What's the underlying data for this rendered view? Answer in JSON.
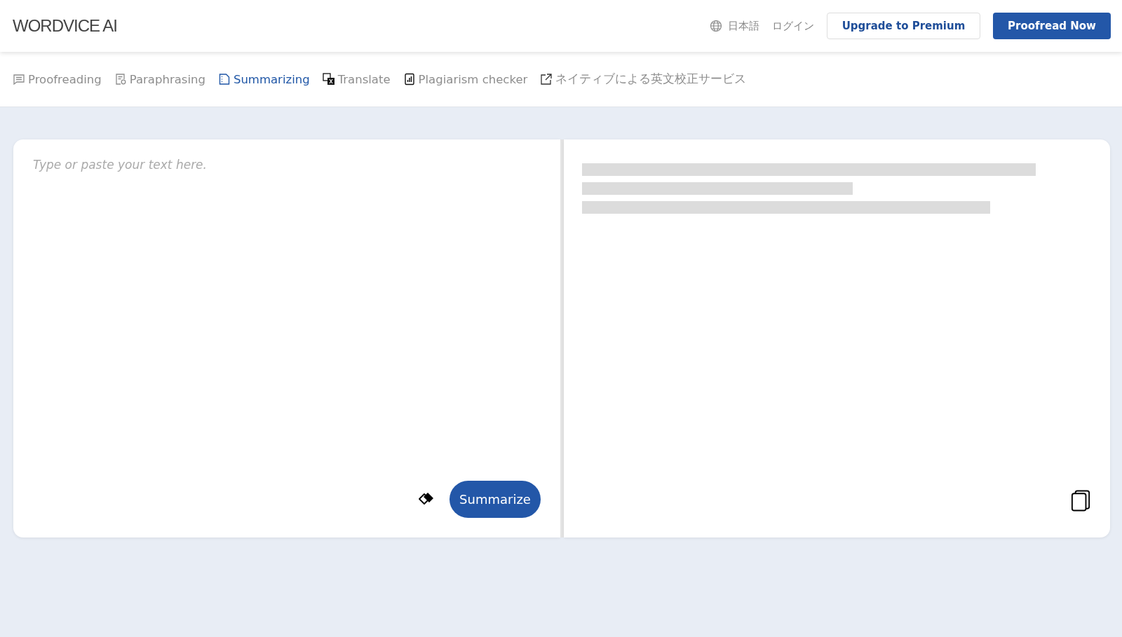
{
  "header": {
    "logo": "WORDVICE AI",
    "language": "日本語",
    "login": "ログイン",
    "upgrade_button": "Upgrade to Premium",
    "proofread_button": "Proofread Now"
  },
  "tabs": [
    {
      "label": "Proofreading",
      "kind": "proofread",
      "selected": false
    },
    {
      "label": "Paraphrasing",
      "kind": "paraphrase",
      "selected": false
    },
    {
      "label": "Summarizing",
      "kind": "summary",
      "selected": true
    },
    {
      "label": "Translate",
      "kind": "translate",
      "selected": false
    },
    {
      "label": "Plagiarism checker",
      "kind": "plagiarism",
      "selected": false
    },
    {
      "label": "ネイティブによる英文校正サービス",
      "kind": "external",
      "selected": false
    }
  ],
  "editor": {
    "placeholder": "Type or paste your text here.",
    "submit_button": "Summarize"
  }
}
